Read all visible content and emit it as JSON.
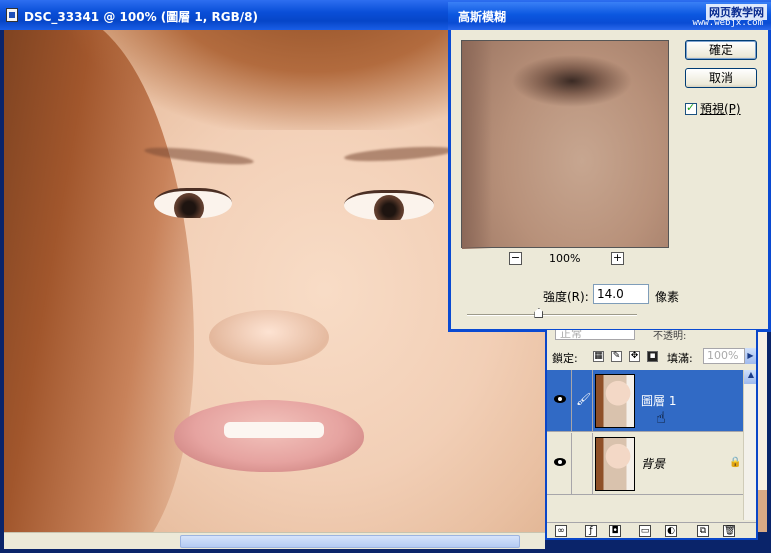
{
  "document": {
    "title": "DSC_33341 @ 100% (圖層 1, RGB/8)"
  },
  "dialog": {
    "title": "高斯模糊",
    "watermark": "网页教学网",
    "watermark_sub": "www.webjx.com",
    "ok_label": "確定",
    "cancel_label": "取消",
    "preview_label": "預視(P)",
    "preview_checked": true,
    "zoom_minus": "−",
    "zoom_level": "100%",
    "zoom_plus": "+",
    "radius_label": "強度(R):",
    "radius_value": "14.0",
    "radius_unit": "像素",
    "radius_slider_fraction": 0.42
  },
  "layers": {
    "blend_mode": "正常",
    "opacity_label": "不透明:",
    "lock_label": "鎖定:",
    "fill_label": "填滿:",
    "fill_value": "100%",
    "items": [
      {
        "name": "圖層 1",
        "selected": true,
        "visible": true
      },
      {
        "name": "背景",
        "selected": false,
        "visible": true,
        "locked": true
      }
    ]
  }
}
